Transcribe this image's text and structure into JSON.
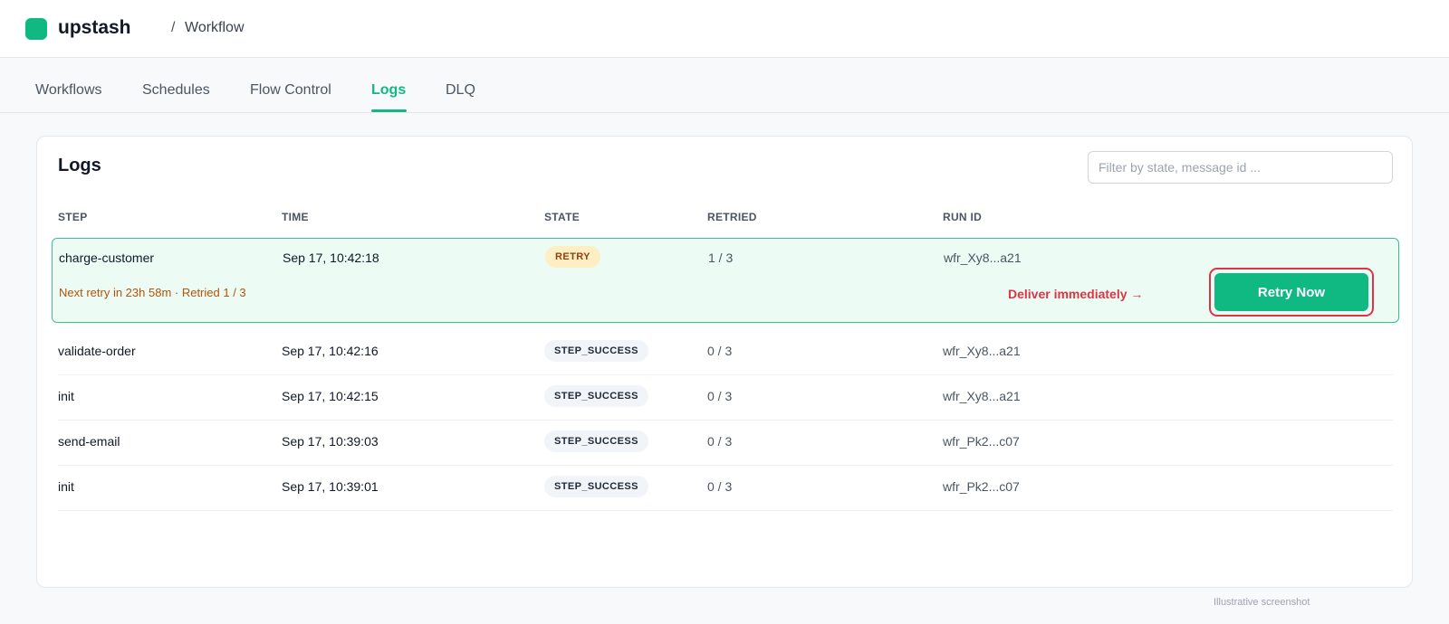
{
  "header": {
    "brand": "upstash",
    "breadcrumb_separator": "/",
    "breadcrumb": "Workflow"
  },
  "tabs": [
    {
      "label": "Workflows",
      "active": false
    },
    {
      "label": "Schedules",
      "active": false
    },
    {
      "label": "Flow Control",
      "active": false
    },
    {
      "label": "Logs",
      "active": true
    },
    {
      "label": "DLQ",
      "active": false
    }
  ],
  "logs": {
    "title": "Logs",
    "filter_placeholder": "Filter by state, message id ...",
    "filter_value": "",
    "columns": [
      "STEP",
      "TIME",
      "STATE",
      "RETRIED",
      "RUN ID"
    ],
    "active_row": {
      "step": "charge-customer",
      "time": "Sep 17, 10:42:18",
      "state": "RETRY",
      "retried": "1 / 3",
      "run_id": "wfr_Xy8...a21",
      "note": "Next retry in 23h 58m  ·  Retried 1 / 3",
      "deliver_label": "Deliver immediately →",
      "retry_button": "Retry Now"
    },
    "rows": [
      {
        "step": "validate-order",
        "time": "Sep 17, 10:42:16",
        "state": "STEP_SUCCESS",
        "retried": "0 / 3",
        "run_id": "wfr_Xy8...a21"
      },
      {
        "step": "init",
        "time": "Sep 17, 10:42:15",
        "state": "STEP_SUCCESS",
        "retried": "0 / 3",
        "run_id": "wfr_Xy8...a21"
      },
      {
        "step": "send-email",
        "time": "Sep 17, 10:39:03",
        "state": "STEP_SUCCESS",
        "retried": "0 / 3",
        "run_id": "wfr_Pk2...c07"
      },
      {
        "step": "init",
        "time": "Sep 17, 10:39:01",
        "state": "STEP_SUCCESS",
        "retried": "0 / 3",
        "run_id": "wfr_Pk2...c07"
      }
    ]
  },
  "footnote": "Illustrative screenshot",
  "colors": {
    "accent": "#10b981",
    "highlight": "#dc3545",
    "retry_badge_bg": "#fdeec3",
    "active_row_bg": "#ecfbf3"
  }
}
